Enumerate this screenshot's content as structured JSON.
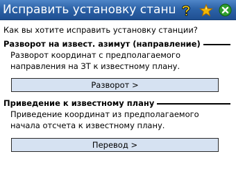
{
  "window": {
    "title": "Исправить установку станци",
    "buttons": {
      "help": "help-icon",
      "favorite": "star-icon",
      "close": "close-icon"
    }
  },
  "question": "Как вы хотите исправить установку станции?",
  "sections": [
    {
      "heading": "Разворот на извест. азимут (направление)",
      "description_lines": [
        "Разворот координат с предполагаемого",
        "направления на ЗТ к известному плану."
      ],
      "button_label": "Разворот >"
    },
    {
      "heading": "Приведение к известному плану",
      "description_lines": [
        "Приведение координат из предполагаемого",
        "начала отсчета к известному плану."
      ],
      "button_label": "Перевод >"
    }
  ],
  "colors": {
    "titlebar": "#2d63a8",
    "button_fill": "#d6e2f2",
    "close_icon": "#2e9e2e",
    "star_icon": "#f2b705"
  }
}
